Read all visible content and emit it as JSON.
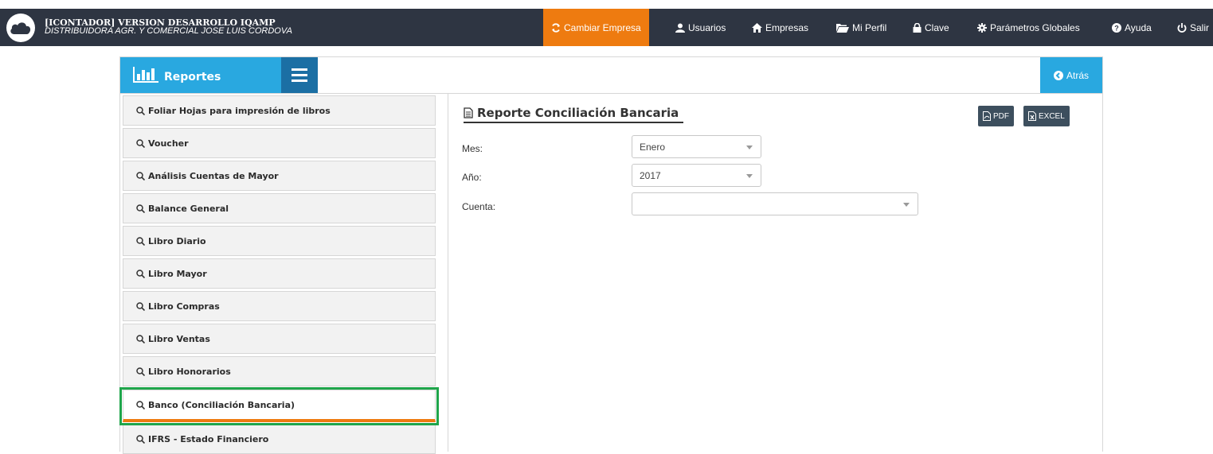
{
  "header": {
    "title": "[ICONTADOR] VERSION DESARROLLO IQAMP",
    "subtitle": "DISTRIBUIDORA AGR. Y COMERCIAL JOSE LUIS CORDOVA",
    "nav": {
      "cambiar_empresa": "Cambiar Empresa",
      "usuarios": "Usuarios",
      "empresas": "Empresas",
      "mi_perfil": "Mi Perfil",
      "clave": "Clave",
      "parametros": "Parámetros Globales",
      "ayuda": "Ayuda",
      "salir": "Salir"
    }
  },
  "panel": {
    "title": "Reportes",
    "back_label": "Atrás"
  },
  "sidebar": {
    "items": [
      {
        "label": "Foliar Hojas para impresión de libros"
      },
      {
        "label": "Voucher"
      },
      {
        "label": "Análisis Cuentas de Mayor"
      },
      {
        "label": "Balance General"
      },
      {
        "label": "Libro Diario"
      },
      {
        "label": "Libro Mayor"
      },
      {
        "label": "Libro Compras"
      },
      {
        "label": "Libro Ventas"
      },
      {
        "label": "Libro Honorarios"
      },
      {
        "label": "Banco (Conciliación Bancaria)"
      },
      {
        "label": "IFRS - Estado Financiero"
      }
    ],
    "active_index": 9
  },
  "report": {
    "title": "Reporte Conciliación Bancaria",
    "pdf_label": "PDF",
    "excel_label": "EXCEL",
    "fields": {
      "mes_label": "Mes:",
      "mes_value": "Enero",
      "anio_label": "Año:",
      "anio_value": "2017",
      "cuenta_label": "Cuenta:",
      "cuenta_value": ""
    }
  },
  "colors": {
    "topbar": "#2e3542",
    "accent_orange": "#ee7b10",
    "accent_blue": "#29a8e0",
    "menu_dark_blue": "#1b6fa4",
    "highlight_green": "#1fa54b"
  }
}
